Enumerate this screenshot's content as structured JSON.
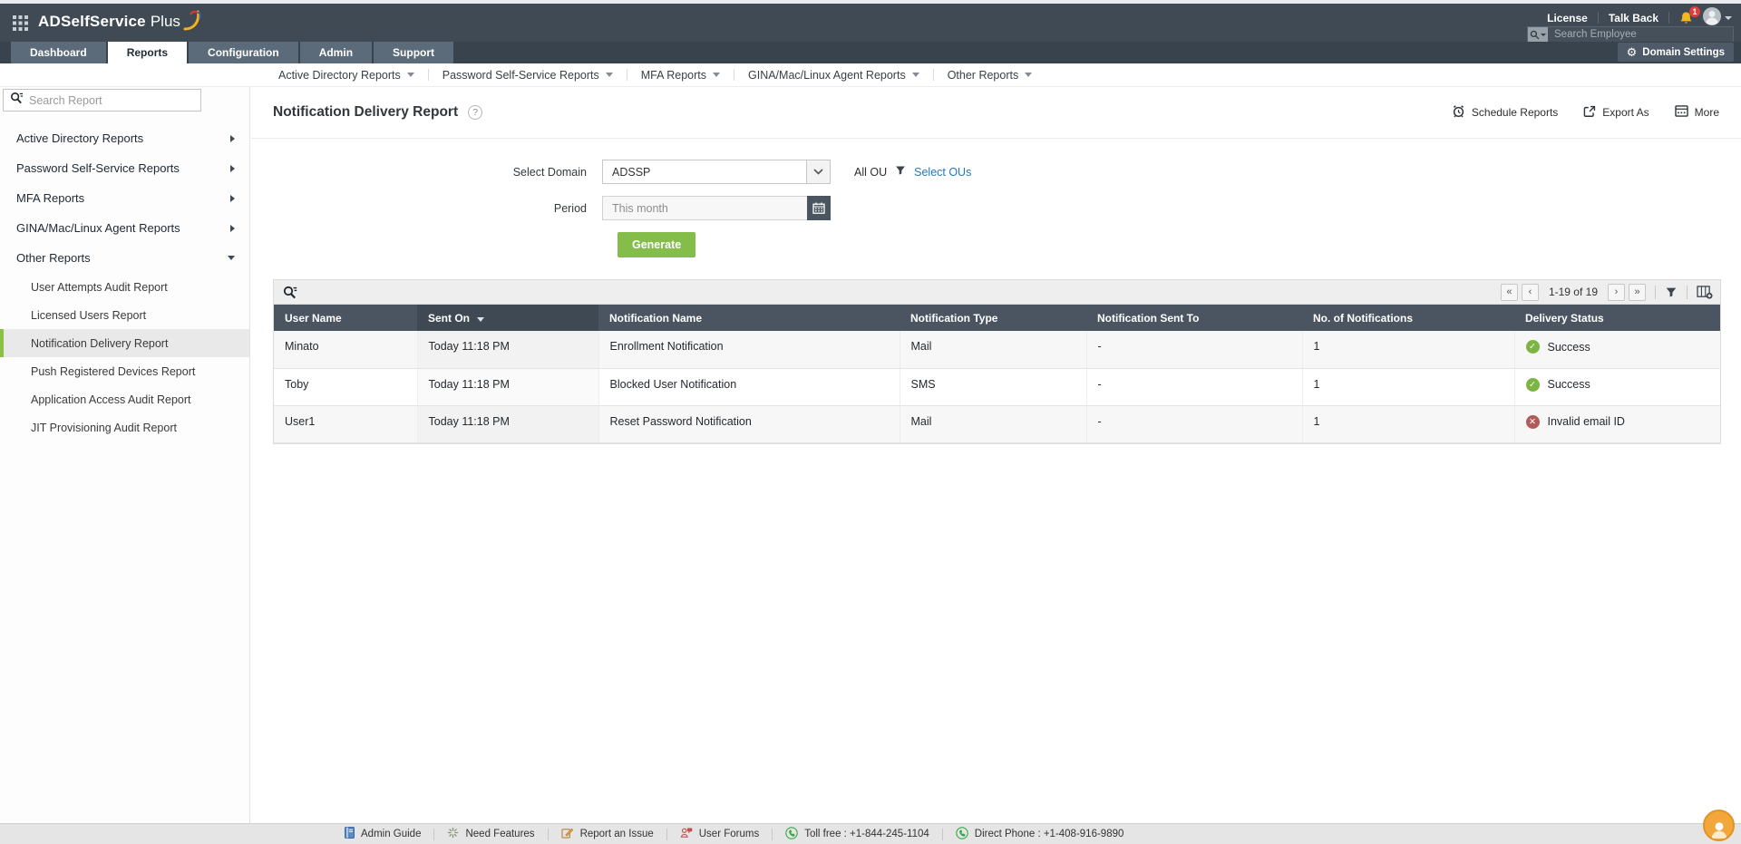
{
  "topbar": {
    "brand_bold": "ADSelfService",
    "brand_light": "Plus",
    "license_label": "License",
    "talkback_label": "Talk Back",
    "notification_count": "1",
    "employee_search_placeholder": "Search Employee"
  },
  "tabs": {
    "items": [
      {
        "label": "Dashboard"
      },
      {
        "label": "Reports"
      },
      {
        "label": "Configuration"
      },
      {
        "label": "Admin"
      },
      {
        "label": "Support"
      }
    ],
    "active_label": "Reports",
    "domain_settings_label": "Domain Settings"
  },
  "report_nav": {
    "items": [
      {
        "label": "Active Directory Reports"
      },
      {
        "label": "Password Self-Service Reports"
      },
      {
        "label": "MFA Reports"
      },
      {
        "label": "GINA/Mac/Linux Agent Reports"
      },
      {
        "label": "Other Reports"
      }
    ]
  },
  "sidebar": {
    "search_placeholder": "Search Report",
    "items": [
      {
        "label": "Active Directory Reports"
      },
      {
        "label": "Password Self-Service Reports"
      },
      {
        "label": "MFA Reports"
      },
      {
        "label": "GINA/Mac/Linux Agent Reports"
      },
      {
        "label": "Other Reports"
      }
    ],
    "sub_items": [
      {
        "label": "User Attempts Audit Report"
      },
      {
        "label": "Licensed Users Report"
      },
      {
        "label": "Notification Delivery Report",
        "selected": true
      },
      {
        "label": "Push Registered Devices Report"
      },
      {
        "label": "Application Access Audit Report"
      },
      {
        "label": "JIT Provisioning Audit Report"
      }
    ]
  },
  "page": {
    "title": "Notification Delivery Report",
    "help_glyph": "?",
    "toolbar": {
      "schedule_label": "Schedule Reports",
      "export_label": "Export As",
      "more_label": "More"
    }
  },
  "form": {
    "domain_label": "Select Domain",
    "domain_value": "ADSSP",
    "all_ou_label": "All OU",
    "select_ous_label": "Select OUs",
    "period_label": "Period",
    "period_placeholder": "This month",
    "generate_label": "Generate"
  },
  "table": {
    "pagination_range": "1-19 of 19",
    "columns": [
      {
        "label": "User Name"
      },
      {
        "label": "Sent On",
        "sorted": "desc"
      },
      {
        "label": "Notification Name"
      },
      {
        "label": "Notification Type"
      },
      {
        "label": "Notification Sent To"
      },
      {
        "label": "No. of Notifications"
      },
      {
        "label": "Delivery Status"
      }
    ],
    "rows": [
      {
        "user_name": "Minato",
        "sent_on": "Today 11:18 PM",
        "notification_name": "Enrollment Notification",
        "notification_type": "Mail",
        "notification_sent_to": "-",
        "no_of_notifications": "1",
        "status": {
          "label": "Success",
          "type": "success"
        }
      },
      {
        "user_name": "Toby",
        "sent_on": "Today 11:18 PM",
        "notification_name": "Blocked User Notification",
        "notification_type": "SMS",
        "notification_sent_to": "-",
        "no_of_notifications": "1",
        "status": {
          "label": "Success",
          "type": "success"
        }
      },
      {
        "user_name": "User1",
        "sent_on": "Today 11:18 PM",
        "notification_name": "Reset Password Notification",
        "notification_type": "Mail",
        "notification_sent_to": "-",
        "no_of_notifications": "1",
        "status": {
          "label": "Invalid email ID",
          "type": "error"
        }
      }
    ]
  },
  "footer": {
    "admin_guide_label": "Admin Guide",
    "need_features_label": "Need Features",
    "report_issue_label": "Report an Issue",
    "user_forums_label": "User Forums",
    "toll_free_label": "Toll free : +1-844-245-1104",
    "direct_phone_label": "Direct Phone : +1-408-916-9890"
  },
  "colors": {
    "topbar": "#404a54",
    "tab_bg": "#5b6b7a",
    "tab_active_bg": "#ffffff",
    "accent_green": "#85bd4b",
    "link_blue": "#2277bc",
    "table_header_bg": "#4a5561",
    "success": "#7cb543",
    "error": "#b15b5b",
    "bell_yellow": "#f4b71f",
    "badge_red": "#e03d3d"
  }
}
